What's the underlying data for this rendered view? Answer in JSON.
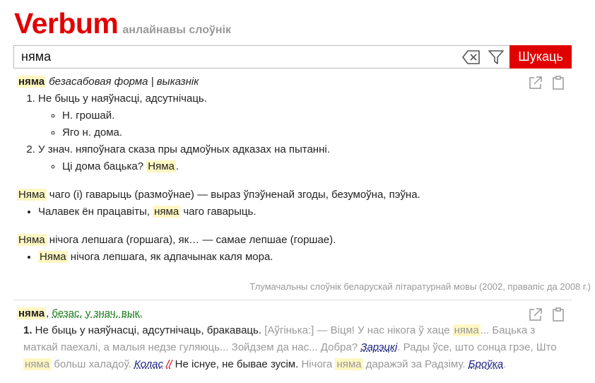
{
  "header": {
    "logo": "Verbum",
    "tagline": "анлайнавы слоўнік"
  },
  "search": {
    "value": "няма",
    "button_label": "Шукаць"
  },
  "entry1": {
    "headword": "няма",
    "grammar": "безасабовая форма | выказнік",
    "senses": [
      {
        "text": "Не быць у наяўнасці, адсутнічаць.",
        "examples": [
          "Н. грошай.",
          "Яго н. дома."
        ]
      },
      {
        "text": "У знач. няпоўнага сказа пры адмоўных адказах на пытанні.",
        "example_pre": "Ці дома бацька? ",
        "example_hl": "Няма",
        "example_post": "."
      }
    ],
    "phrase1": {
      "hl": "Няма",
      "rest": " чаго (і) гаварыць (размоўнае) — выраз ўпэўненай згоды, безумоўна, пэўна.",
      "example_pre": "Чалавек ён працавіты, ",
      "example_hl": "няма",
      "example_post": " чаго гаварыць."
    },
    "phrase2": {
      "hl": "Няма",
      "rest": " нічога лепшага (горшага), як… — самае лепшае (горшае).",
      "example_hl": "Няма",
      "example_post": " нічога лепшага, як адпачынак каля мора."
    },
    "source": "Тлумачальны слоўнік беларускай літаратурнай мовы (2002, правапіс да 2008 г.)"
  },
  "entry2": {
    "headword": "няма",
    "sep": ", ",
    "grammar1": "безас.",
    "grammar2": "у знач. вык.",
    "num": "1.",
    "def1": " Не быць у наяўнасці, адсутнічаць, бракаваць. ",
    "q1": "[Аўгінька:] — Віця! У нас нікога ў хаце ",
    "q1_hl": "няма",
    "q2": "... Бацька з маткай паехалі, а малыя недзе гуляюць... Зойдзем да нас... Добра? ",
    "author1": "Зарэцкі",
    "q3": ". Рады ўсе, што сонца грэе, Што ",
    "q3_hl": "няма",
    "q4": " больш халадоў. ",
    "author2": "Колас",
    "mark": "//",
    "def2": " Не існуе, не бывае зусім. ",
    "q5": "Нічога ",
    "q5_hl": "няма",
    "q6": " даражэй за Радзіму. ",
    "author3": "Броўка",
    "q7": "."
  }
}
